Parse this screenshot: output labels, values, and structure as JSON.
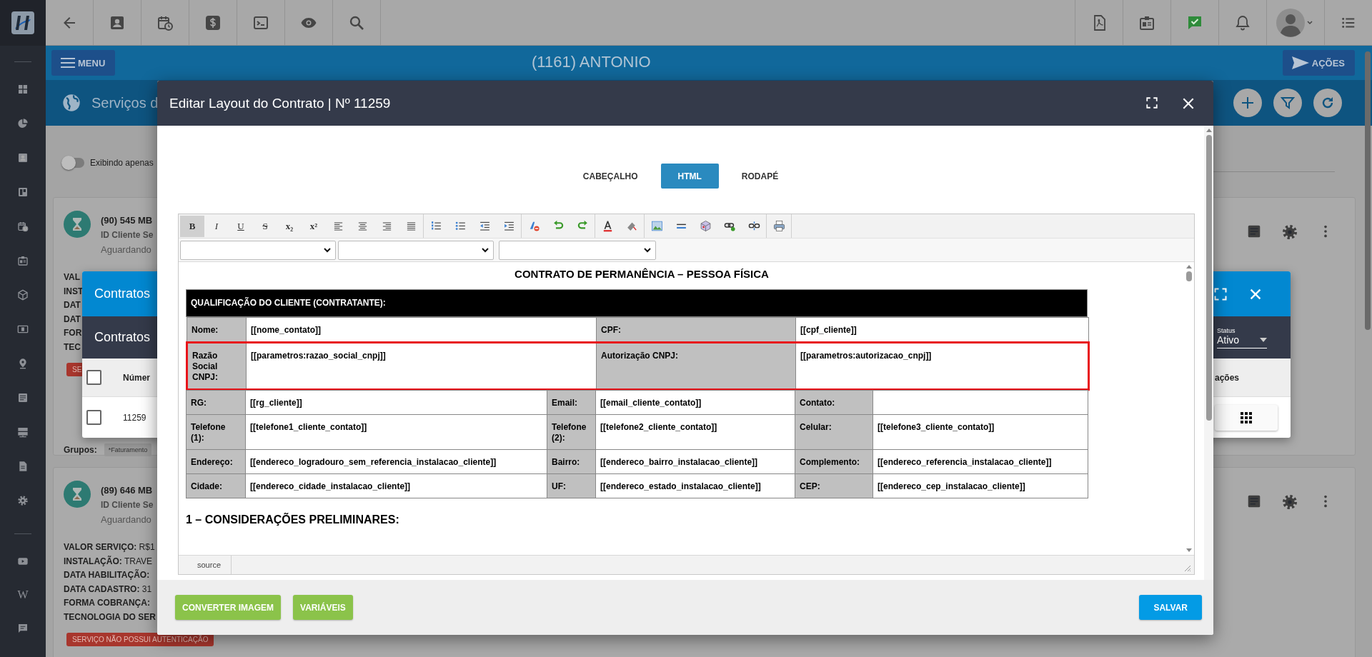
{
  "sidebar": {
    "wiki_glyph": "W"
  },
  "header": {
    "menu_button": "MENU",
    "client_title": "(1161) ANTONIO",
    "actions_button": "AÇÕES"
  },
  "page": {
    "title": "Serviços d",
    "filter_toggle": {
      "label": "Exibindo apenas",
      "on": false
    }
  },
  "service_cards": [
    {
      "title": "(90) 545 MB",
      "client_id": "ID Cliente Se",
      "status": "Aguardando",
      "fields": [
        {
          "label": "VAL"
        },
        {
          "label": "INST"
        },
        {
          "label": "DAT"
        },
        {
          "label": "DAT"
        },
        {
          "label": "FOR"
        },
        {
          "label": "TEC"
        }
      ],
      "badge": "SE",
      "groups_label": "Grupos:",
      "group_tag": "*Faturamento"
    },
    {
      "title": "(89) 646 MB",
      "client_id": "ID Cliente Se",
      "status": "Aguardando",
      "fields": [
        {
          "label": "VALOR SERVIÇO:",
          "value": "R$1"
        },
        {
          "label": "INSTALAÇÃO:",
          "value": "TRAVE"
        },
        {
          "label": "DATA HABILITAÇÃO:"
        },
        {
          "label": "DATA CADASTRO:",
          "value": "31"
        },
        {
          "label": "FORMA COBRANÇA:"
        },
        {
          "label": "TECNOLOGIA DO SER"
        }
      ],
      "badge": "SERVIÇO NÃO POSSUI AUTENTICAÇÃO"
    }
  ],
  "contracts_dialog": {
    "title": "Contratos",
    "subtitle": "Contratos",
    "status_filter": {
      "label": "Status",
      "value": "Ativo"
    },
    "select_all": {
      "checked": false
    },
    "columns": [
      "Númer",
      "ações"
    ],
    "rows": [
      {
        "checked": false,
        "number": "11259"
      }
    ]
  },
  "modal": {
    "title": "Editar Layout do Contrato | Nº 11259",
    "tabs": [
      {
        "label": "CABEÇALHO",
        "selected": false
      },
      {
        "label": "HTML",
        "selected": true
      },
      {
        "label": "RODAPÉ",
        "selected": false
      }
    ],
    "style_buttons": [
      {
        "label": "B",
        "active": true
      },
      {
        "label": "I",
        "active": false
      },
      {
        "label": "U",
        "active": false
      },
      {
        "label": "S",
        "active": false
      },
      {
        "label": "x₂",
        "active": false
      },
      {
        "label": "x²",
        "active": false
      }
    ],
    "document": {
      "title": "CONTRATO DE PERMANÊNCIA – PESSOA FÍSICA",
      "table_heading": "QUALIFICAÇÃO DO CLIENTE (CONTRATANTE):",
      "upper_rows": [
        {
          "highlighted": false,
          "cells": [
            "Nome:",
            "[[nome_contato]]",
            "CPF:",
            "[[cpf_cliente]]"
          ]
        },
        {
          "highlighted": true,
          "cells": [
            "Razão Social CNPJ:",
            "[[parametros:razao_social_cnpj]]",
            "Autorização CNPJ:",
            "[[parametros:autorizacao_cnpj]]"
          ]
        }
      ],
      "lower_rows": [
        {
          "highlighted": false,
          "cells": [
            "RG:",
            "[[rg_cliente]]",
            "Email:",
            "[[email_cliente_contato]]",
            "Contato:",
            null
          ]
        },
        {
          "highlighted": false,
          "cells": [
            "Telefone (1):",
            "[[telefone1_cliente_contato]]",
            "Telefone (2):",
            "[[telefone2_cliente_contato]]",
            "Celular:",
            "[[telefone3_cliente_contato]]"
          ]
        },
        {
          "highlighted": false,
          "cells": [
            "Endereço:",
            "[[endereco_logradouro_sem_referencia_instalacao_cliente]]",
            "Bairro:",
            "[[endereco_bairro_instalacao_cliente]]",
            "Complemento:",
            "[[endereco_referencia_instalacao_cliente]]"
          ]
        },
        {
          "highlighted": false,
          "cells": [
            "Cidade:",
            "[[endereco_cidade_instalacao_cliente]]",
            "UF:",
            "[[endereco_estado_instalacao_cliente]]",
            "CEP:",
            "[[endereco_cep_instalacao_cliente]]"
          ]
        }
      ],
      "section_heading": "1 – CONSIDERAÇÕES PRELIMINARES:"
    },
    "source_tab": "source",
    "footer_buttons": [
      {
        "label": "CONVERTER IMAGEM",
        "kind": "secondary"
      },
      {
        "label": "VARIÁVEIS",
        "kind": "secondary"
      },
      {
        "label": "SALVAR",
        "kind": "primary"
      }
    ]
  }
}
